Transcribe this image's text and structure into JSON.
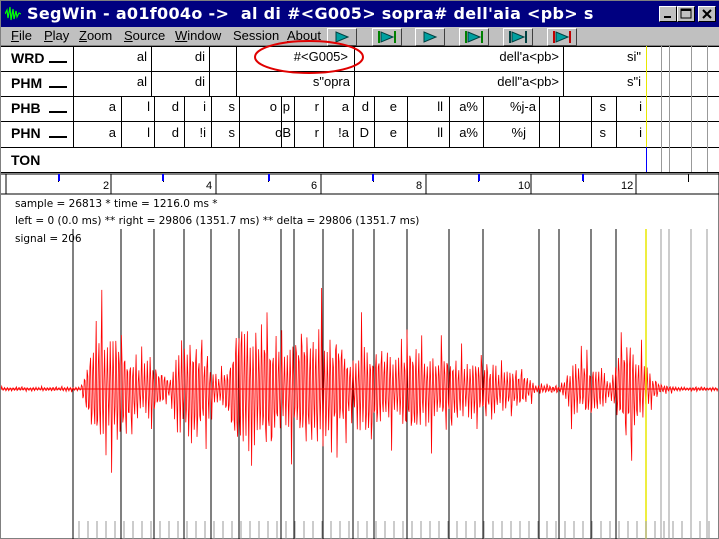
{
  "window": {
    "title": "SegWin - a01f004o ->  al di #<G005> sopra# dell'aia <pb> s",
    "controls": [
      "minimize",
      "maximize",
      "close"
    ]
  },
  "menu": {
    "items": [
      {
        "label": "File",
        "accel": "F"
      },
      {
        "label": "Play",
        "accel": "P"
      },
      {
        "label": "Zoom",
        "accel": "Z"
      },
      {
        "label": "Source",
        "accel": "S"
      },
      {
        "label": "Window",
        "accel": "W"
      },
      {
        "label": "Session",
        "accel": ""
      },
      {
        "label": "About",
        "accel": "A"
      }
    ]
  },
  "toolbar": {
    "play_buttons": [
      {
        "icon": "play-icon",
        "color": "#00a0a0",
        "bars": "none"
      },
      {
        "icon": "play-from-start-icon",
        "color": "#00a0a0",
        "bars": "green"
      },
      {
        "icon": "play-to-end-icon",
        "color": "#00a0a0",
        "bars": "none"
      },
      {
        "icon": "play-selection-icon",
        "color": "#00a0a0",
        "bars": "green"
      },
      {
        "icon": "play-left-icon",
        "color": "#00a0a0",
        "bars": "dark"
      },
      {
        "icon": "play-right-icon",
        "color": "#00a0a0",
        "bars": "red"
      }
    ]
  },
  "tiers": {
    "wrd": {
      "name": "WRD",
      "segments": [
        "al",
        "di",
        "#<G005>",
        "dell'a<pb>",
        "si\""
      ]
    },
    "phm": {
      "name": "PHM",
      "segments": [
        "al",
        "di",
        "s\"opra",
        "dell\"a<pb>",
        "s\"i"
      ]
    },
    "phb": {
      "name": "PHB",
      "segments": [
        "a",
        "l",
        "d",
        "i",
        "s",
        "o",
        "p",
        "r",
        "a",
        "d",
        "e",
        "ll",
        "a%",
        "%j-a",
        "s",
        "i"
      ]
    },
    "phn": {
      "name": "PHN",
      "segments": [
        "a",
        "l",
        "d",
        "!i",
        "s",
        "oB",
        "r",
        "!a",
        "D",
        "e",
        "ll",
        "a%",
        "%j",
        "s",
        "i"
      ]
    },
    "ton": {
      "name": "TON",
      "segments": []
    }
  },
  "ruler": {
    "labels": [
      "2",
      "4",
      "6",
      "8",
      "10",
      "12"
    ]
  },
  "info": {
    "sample_line": "sample = 26813 * time = 1216.0 ms *",
    "range_line": "left = 0 (0.0 ms) ** right = 29806 (1351.7 ms) ** delta = 29806 (1351.7 ms)",
    "signal_line": "signal = 206"
  },
  "colors": {
    "title_bar": "#000080",
    "waveform": "#ff0000",
    "cursor": "#ffff00",
    "annotation_circle": "#ff0000",
    "marker": "#0000ff"
  }
}
